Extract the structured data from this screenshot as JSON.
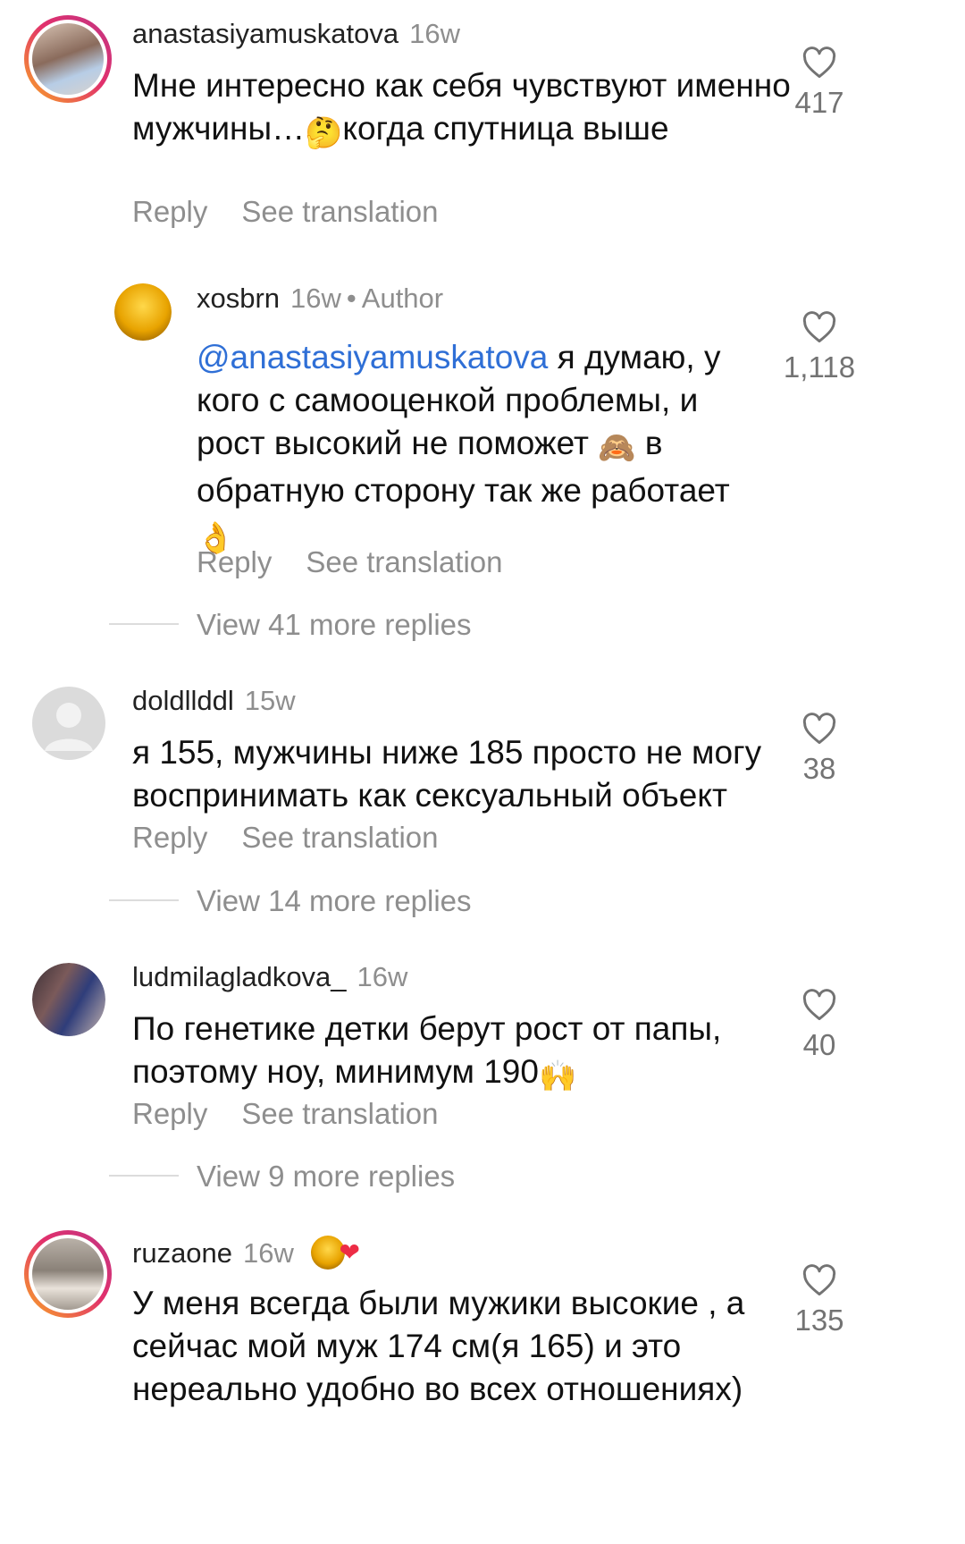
{
  "reply_label": "Reply",
  "translate_label": "See translation",
  "comments": [
    {
      "username": "anastasiyamuskatova",
      "time": "16w",
      "text_before": "Мне интересно как себя чувствуют именно мужчины…",
      "emoji": "🤔",
      "text_after": "когда спутница выше",
      "likes": "417"
    },
    {
      "username": "xosbrn",
      "time": "16w",
      "dot": "•",
      "badge": "Author",
      "mention": "@anastasiyamuskatova",
      "text_before": " я думаю, у кого с самооценкой проблемы, и рост высокий не поможет ",
      "emoji": "🙈",
      "text_after": " в обратную сторону так же работает ",
      "emoji2": "👌",
      "likes": "1,118"
    },
    {
      "username": "doldllddl",
      "time": "15w",
      "text": "я 155, мужчины ниже 185 просто не могу воспринимать как сексуальный объект",
      "likes": "38",
      "more_replies": "View 14 more replies"
    },
    {
      "username": "ludmilagladkova_",
      "time": "16w",
      "text_before": "По генетике детки берут рост от папы, поэтому ноу, минимум 190",
      "emoji": "🙌",
      "likes": "40",
      "more_replies": "View 9 more replies"
    },
    {
      "username": "ruzaone",
      "time": "16w",
      "liked_emoji": "❤",
      "text": "У меня всегда были мужики высокие , а сейчас мой муж 174 см(я 165) и это нереально удобно во всех отношениях)",
      "likes": "135"
    }
  ],
  "thread_more_replies": "View 41 more replies",
  "icons": {
    "like": "heart-outline-icon",
    "liked": "red-heart-icon"
  },
  "colors": {
    "mention": "#2f6fd6",
    "secondary": "#8e8e8e",
    "heart_red": "#ed2c45"
  }
}
